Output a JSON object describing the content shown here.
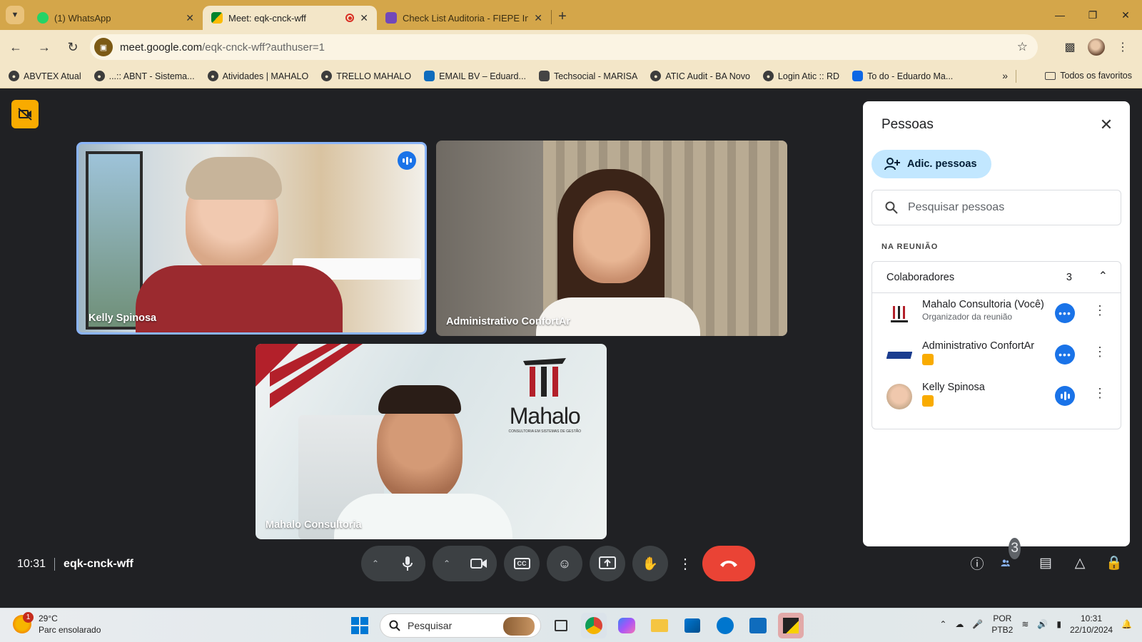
{
  "browser": {
    "tabs": [
      {
        "label": "(1) WhatsApp",
        "active": false
      },
      {
        "label": "Meet: eqk-cnck-wff",
        "active": true
      },
      {
        "label": "Check List Auditoria - FIEPE Ind",
        "active": false
      }
    ],
    "url_main": "meet.google.com",
    "url_rest": "/eqk-cnck-wff?authuser=1",
    "bookmarks": [
      "ABVTEX Atual",
      "...:: ABNT - Sistema...",
      "Atividades | MAHALO",
      "TRELLO MAHALO",
      "EMAIL BV – Eduard...",
      "Techsocial - MARISA",
      "ATIC Audit - BA Novo",
      "Login Atic :: RD",
      "To do - Eduardo Ma..."
    ],
    "all_bookmarks": "Todos os favoritos",
    "colors": {
      "frame": "#d4a64a",
      "toolbar": "#f3e6c8"
    }
  },
  "meet": {
    "tiles": [
      {
        "name": "Kelly Spinosa",
        "speaking": true
      },
      {
        "name": "Administrativo ConfortAr",
        "speaking": false
      },
      {
        "name": "Mahalo Consultoria",
        "speaking": false
      }
    ],
    "logo_word": "Mahalo",
    "logo_tag": "CONSULTORIA EM SISTEMAS DE GESTÃO",
    "time": "10:31",
    "meeting_code": "eqk-cnck-wff",
    "participants_count": "3"
  },
  "panel": {
    "title": "Pessoas",
    "add_label": "Adic. pessoas",
    "search_placeholder": "Pesquisar pessoas",
    "section_label": "NA REUNIÃO",
    "group_label": "Colaboradores",
    "group_count": "3",
    "people": [
      {
        "name": "Mahalo Consultoria (Você)",
        "sub": "Organizador da reunião",
        "icon": "more-horizontal-icon"
      },
      {
        "name": "Administrativo ConfortAr",
        "sub": "",
        "icon": "more-horizontal-icon"
      },
      {
        "name": "Kelly Spinosa",
        "sub": "",
        "icon": "audio-level-icon"
      }
    ]
  },
  "taskbar": {
    "temp": "29°C",
    "weather": "Parc ensolarado",
    "weather_badge": "1",
    "search_label": "Pesquisar",
    "lang1": "POR",
    "lang2": "PTB2",
    "clock_time": "10:31",
    "clock_date": "22/10/2024"
  }
}
